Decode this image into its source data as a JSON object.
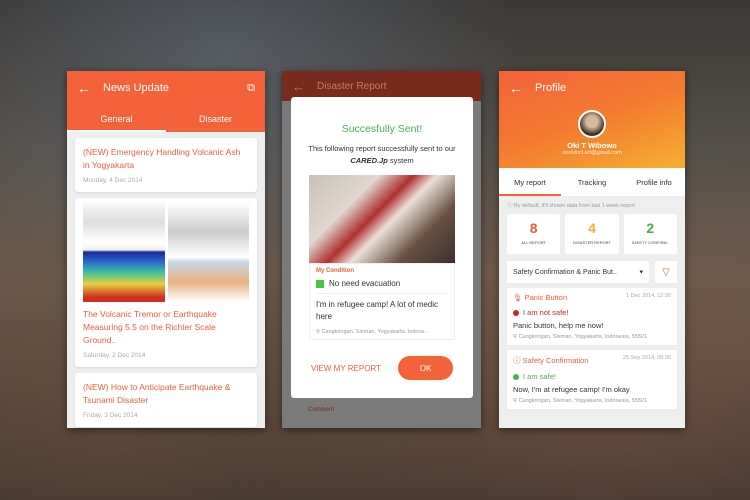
{
  "colors": {
    "primary": "#f4623a",
    "success": "#4caf50",
    "warning": "#f5b030",
    "danger": "#c62828"
  },
  "news": {
    "title": "News Update",
    "tabs": [
      "General",
      "Disaster"
    ],
    "active_tab": "General",
    "articles": [
      {
        "title": "(NEW) Emergency Handling Volcanic Ash in Yogyakarta",
        "date": "Monday, 4 Dec 2014"
      },
      {
        "title": "The Volcanic Tremor or Earthquake Measuring 5.5 on the Richter Scale Ground..",
        "date": "Saturday, 2 Dec 2014"
      },
      {
        "title": "(NEW) How to Anticipate Earthquake & Tsunami Disaster",
        "date": "Friday, 3 Dec 2014"
      }
    ]
  },
  "report": {
    "title": "Disaster Report",
    "dialog_title": "Succesfully Sent!",
    "text_before": "This following report successfully sent to our ",
    "system": "CARED.Jp",
    "text_after": " system",
    "condition_label": "My Condition",
    "condition": "No need evacuation",
    "message": "I'm in refugee camp! A lot of medic here",
    "location": "Cangkringan, Sleman, Yogyakarta, Indone..",
    "view_label": "VIEW MY REPORT",
    "ok_label": "OK",
    "comment_label": "Comment"
  },
  "profile": {
    "title": "Profile",
    "name": "Oki T Wibowo",
    "email": "oxxivinci.art@gmail.com",
    "tabs": [
      "My report",
      "Tracking",
      "Profile info"
    ],
    "active_tab": "My report",
    "info": "By default, it'll shown data from last 1 week report",
    "stats": [
      {
        "value": "8",
        "label": "ALL REPORT",
        "color": "#e8603c"
      },
      {
        "value": "4",
        "label": "DISASTER REPORT",
        "color": "#f5b030"
      },
      {
        "value": "2",
        "label": "SAFETY CONFIRM..",
        "color": "#4caf50"
      }
    ],
    "filter": "Safety Confirmation & Panic But..",
    "reports": [
      {
        "type": "Panic Button",
        "time": "1 Dec 2014, 12:30",
        "status": "I am not safe!",
        "status_color": "#c62828",
        "message": "Panic button, help me now!",
        "location": "Cangkringan, Sleman, Yogyakarta, Indonesia, 55821"
      },
      {
        "type": "Safety Confirmation",
        "time": "25 Sep 2014, 08:30",
        "status": "I am safe!",
        "status_color": "#4caf50",
        "message": "Now, I'm at refugee camp! I'm okay",
        "location": "Cangkringan, Sleman, Yogyakarta, Indonesia, 55821"
      }
    ]
  }
}
